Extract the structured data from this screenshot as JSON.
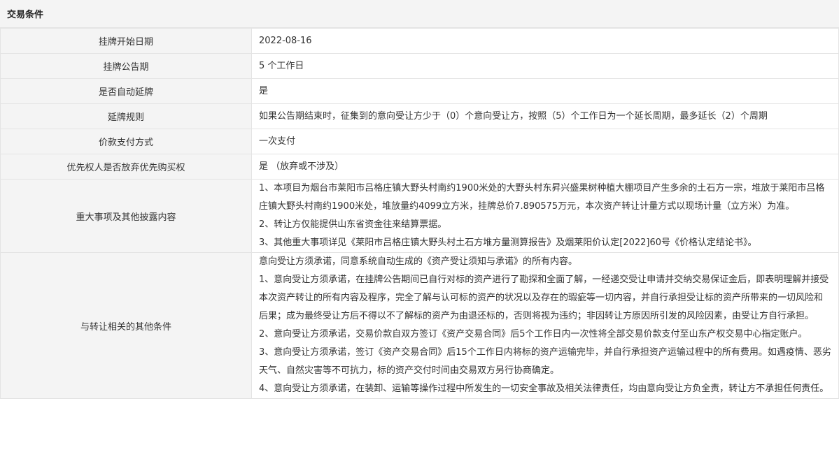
{
  "section_title": "交易条件",
  "rows": [
    {
      "label": "挂牌开始日期",
      "value": "2022-08-16"
    },
    {
      "label": "挂牌公告期",
      "value": "5 个工作日"
    },
    {
      "label": "是否自动延牌",
      "value": "是"
    },
    {
      "label": "延牌规则",
      "value": "如果公告期结束时，征集到的意向受让方少于（0）个意向受让方，按照（5）个工作日为一个延长周期，最多延长（2）个周期"
    },
    {
      "label": "价款支付方式",
      "value": "一次支付"
    },
    {
      "label": "优先权人是否放弃优先购买权",
      "value": "是 （放弃或不涉及）"
    }
  ],
  "major_matters": {
    "label": "重大事项及其他披露内容",
    "paragraphs": [
      "1、本项目为烟台市莱阳市吕格庄镇大野头村南约1900米处的大野头村东昇兴盛果树种植大棚项目产生多余的土石方一宗，堆放于莱阳市吕格庄镇大野头村南约1900米处，堆放量约4099立方米，挂牌总价7.890575万元，本次资产转让计量方式以现场计量（立方米）为准。",
      "2、转让方仅能提供山东省资金往来结算票据。",
      "3、其他重大事项详见《莱阳市吕格庄镇大野头村土石方堆方量测算报告》及烟莱阳价认定[2022]60号《价格认定结论书》。"
    ]
  },
  "other_conditions": {
    "label": "与转让相关的其他条件",
    "paragraphs": [
      "意向受让方须承诺，同意系统自动生成的《资产受让须知与承诺》的所有内容。",
      "1、意向受让方须承诺，在挂牌公告期间已自行对标的资产进行了勘探和全面了解，一经递交受让申请并交纳交易保证金后，即表明理解并接受本次资产转让的所有内容及程序，完全了解与认可标的资产的状况以及存在的瑕疵等一切内容，并自行承担受让标的资产所带来的一切风险和后果；成为最终受让方后不得以不了解标的资产为由退还标的，否则将视为违约；非因转让方原因所引发的风险因素，由受让方自行承担。",
      "2、意向受让方须承诺，交易价款自双方签订《资产交易合同》后5个工作日内一次性将全部交易价款支付至山东产权交易中心指定账户。",
      "3、意向受让方须承诺，签订《资产交易合同》后15个工作日内将标的资产运输完毕，并自行承担资产运输过程中的所有费用。如遇疫情、恶劣天气、自然灾害等不可抗力，标的资产交付时间由交易双方另行协商确定。",
      "4、意向受让方须承诺，在装卸、运输等操作过程中所发生的一切安全事故及相关法律责任，均由意向受让方负全责，转让方不承担任何责任。"
    ]
  }
}
